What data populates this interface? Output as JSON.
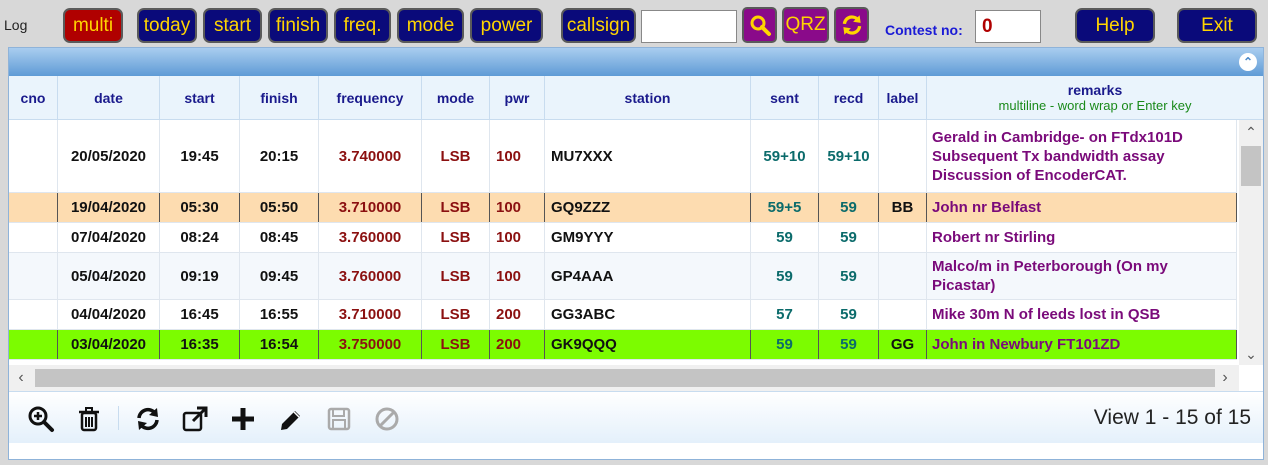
{
  "toolbar": {
    "log_label": "Log",
    "buttons": {
      "multi": "multi",
      "today": "today",
      "start": "start",
      "finish": "finish",
      "freq": "freq.",
      "mode": "mode",
      "power": "power",
      "callsign": "callsign"
    },
    "callsign_value": "",
    "qrz_label": "QRZ",
    "contest_label": "Contest no:",
    "contest_value": "0",
    "help_label": "Help",
    "exit_label": "Exit"
  },
  "columns": {
    "cno": "cno",
    "date": "date",
    "start": "start",
    "finish": "finish",
    "frequency": "frequency",
    "mode": "mode",
    "pwr": "pwr",
    "station": "station",
    "sent": "sent",
    "recd": "recd",
    "label": "label",
    "remarks": "remarks",
    "remarks_hint": "multiline - word wrap or Enter key"
  },
  "rows": [
    {
      "cno": "",
      "date": "20/05/2020",
      "start": "19:45",
      "finish": "20:15",
      "frequency": "3.740000",
      "mode": "LSB",
      "pwr": "100",
      "station": "MU7XXX",
      "sent": "59+10",
      "recd": "59+10",
      "label": "",
      "remarks": [
        "Gerald in Cambridge- on FTdx101D",
        "Subsequent Tx bandwidth assay",
        "Discussion of EncoderCAT."
      ]
    },
    {
      "cno": "",
      "date": "19/04/2020",
      "start": "05:30",
      "finish": "05:50",
      "frequency": "3.710000",
      "mode": "LSB",
      "pwr": "100",
      "station": "GQ9ZZZ",
      "sent": "59+5",
      "recd": "59",
      "label": "BB",
      "remarks": [
        "John nr Belfast"
      ]
    },
    {
      "cno": "",
      "date": "07/04/2020",
      "start": "08:24",
      "finish": "08:45",
      "frequency": "3.760000",
      "mode": "LSB",
      "pwr": "100",
      "station": "GM9YYY",
      "sent": "59",
      "recd": "59",
      "label": "",
      "remarks": [
        "Robert nr Stirling"
      ]
    },
    {
      "cno": "",
      "date": "05/04/2020",
      "start": "09:19",
      "finish": "09:45",
      "frequency": "3.760000",
      "mode": "LSB",
      "pwr": "100",
      "station": "GP4AAA",
      "sent": "59",
      "recd": "59",
      "label": "",
      "remarks": [
        "Malco/m in Peterborough   (On my",
        "Picastar)"
      ]
    },
    {
      "cno": "",
      "date": "04/04/2020",
      "start": "16:45",
      "finish": "16:55",
      "frequency": "3.710000",
      "mode": "LSB",
      "pwr": "200",
      "station": "GG3ABC",
      "sent": "57",
      "recd": "59",
      "label": "",
      "remarks": [
        "Mike 30m N of leeds   lost in QSB"
      ]
    },
    {
      "cno": "",
      "date": "03/04/2020",
      "start": "16:35",
      "finish": "16:54",
      "frequency": "3.750000",
      "mode": "LSB",
      "pwr": "200",
      "station": "GK9QQQ",
      "sent": "59",
      "recd": "59",
      "label": "GG",
      "remarks": [
        "John in Newbury  FT101ZD"
      ]
    }
  ],
  "pager": {
    "view_text": "View 1 - 15 of 15"
  },
  "colors": {
    "button_bg": "#0a0a7a",
    "button_text": "#ffd400",
    "active_button_bg": "#b00000",
    "highlight_orange": "#fddcb0",
    "highlight_green": "#7cfc00"
  }
}
